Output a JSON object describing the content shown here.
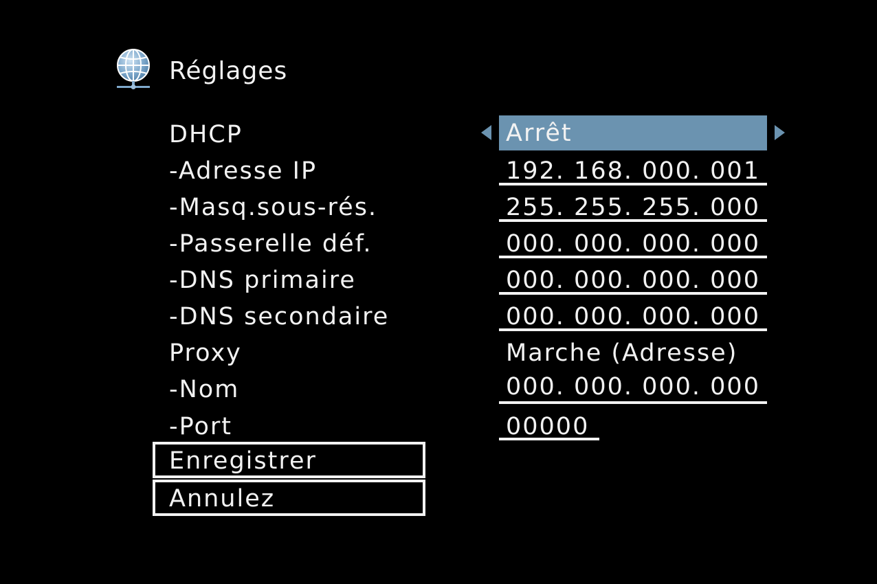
{
  "header": {
    "icon": "globe-network-icon",
    "title": "Réglages"
  },
  "rows": {
    "dhcp": {
      "label": "DHCP",
      "value": "Arrêt"
    },
    "ip": {
      "label": "-Adresse IP",
      "value": "192. 168. 000. 001"
    },
    "mask": {
      "label": "-Masq.sous-rés.",
      "value": "255. 255. 255. 000"
    },
    "gateway": {
      "label": "-Passerelle déf.",
      "value": "000. 000. 000. 000"
    },
    "dns1": {
      "label": "-DNS primaire",
      "value": "000. 000. 000. 000"
    },
    "dns2": {
      "label": "-DNS secondaire",
      "value": "000. 000. 000. 000"
    },
    "proxy": {
      "label": "Proxy",
      "value": "Marche (Adresse)"
    },
    "name": {
      "label": "-Nom",
      "value": "000. 000. 000. 000"
    },
    "port": {
      "label": "-Port",
      "value": "00000"
    }
  },
  "buttons": {
    "save": "Enregistrer",
    "cancel": "Annulez"
  },
  "colors": {
    "background": "#000000",
    "text": "#f2f2f2",
    "accent": "#6b93b0"
  }
}
